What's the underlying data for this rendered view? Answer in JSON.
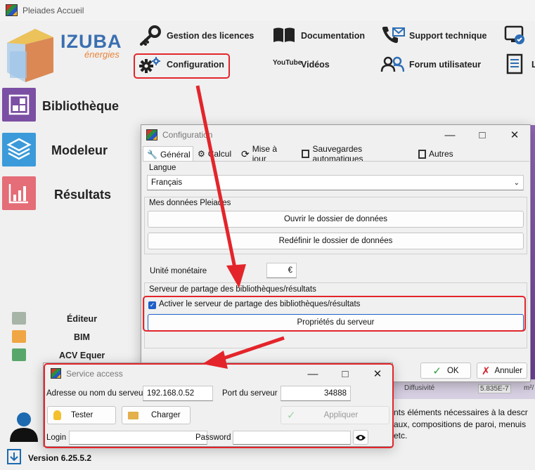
{
  "app": {
    "title": "Pleiades Accueil"
  },
  "logo": {
    "brand": "IZUBA",
    "sub": "énergies"
  },
  "toplinks": {
    "licences": "Gestion des licences",
    "documentation": "Documentation",
    "support": "Support technique",
    "configuration": "Configuration",
    "videos": "Vidéos",
    "youtube": "YouTube",
    "forum": "Forum utilisateur",
    "extra_letter": "L"
  },
  "sidebar": {
    "items": [
      {
        "label": "Bibliothèque",
        "color": "#7b4fa3"
      },
      {
        "label": "Modeleur",
        "color": "#3b9ad9"
      },
      {
        "label": "Résultats",
        "color": "#e46d77"
      }
    ],
    "small": [
      {
        "label": "Éditeur"
      },
      {
        "label": "BIM"
      },
      {
        "label": "ACV Equer"
      }
    ],
    "version": "Version 6.25.5.2"
  },
  "config_dialog": {
    "title": "Configuration",
    "tabs": [
      {
        "label": "Général"
      },
      {
        "label": "Calcul"
      },
      {
        "label": "Mise à jour"
      },
      {
        "label": "Sauvegardes automatiques"
      },
      {
        "label": "Autres"
      }
    ],
    "langue_label": "Langue",
    "langue_value": "Français",
    "donnees_label": "Mes données Pleiades",
    "open_folder": "Ouvrir le dossier de données",
    "redefine_folder": "Redéfinir le dossier de données",
    "currency_label": "Unité monétaire",
    "currency_value": "€",
    "server_group": "Serveur de partage des bibliothèques/résultats",
    "server_checkbox": "Activer le serveur de partage des bibliothèques/résultats",
    "server_props": "Propriétés du serveur",
    "ok": "OK",
    "cancel": "Annuler"
  },
  "background_text": {
    "diffusivity": "Diffusivité",
    "value": "5.835E-7",
    "unit": "m²/",
    "line1": "nts éléments nécessaires à la descr",
    "line2": "aux, compositions de paroi, menuis",
    "line3": "etc."
  },
  "service_dialog": {
    "title": "Service access",
    "address_label": "Adresse ou nom du serveur",
    "address_value": "192.168.0.52",
    "port_label": "Port du serveur",
    "port_value": "34888",
    "test": "Tester",
    "load": "Charger",
    "apply": "Appliquer",
    "login_label": "Login",
    "login_value": "",
    "password_label": "Password",
    "password_value": ""
  },
  "colors": {
    "accent_red": "#e3252b",
    "checkbox_blue": "#1e5fc7",
    "ok_green": "#2e9e3e"
  }
}
